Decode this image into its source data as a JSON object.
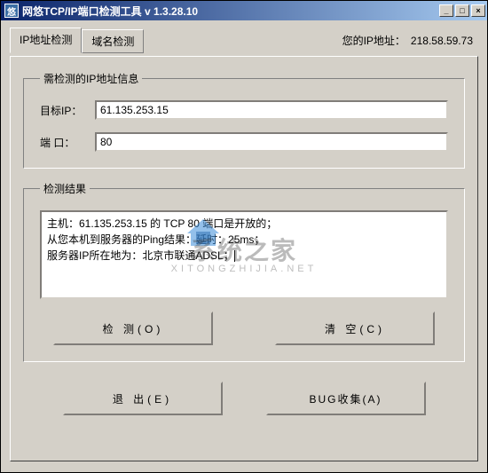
{
  "window": {
    "title": "网悠TCP/IP端口检测工具 v 1.3.28.10",
    "icon_text": "悠"
  },
  "header": {
    "ip_label": "您的IP地址：",
    "ip_value": "218.58.59.73"
  },
  "tabs": {
    "ip_check": "IP地址检测",
    "domain_check": "域名检测"
  },
  "input_group": {
    "legend": "需检测的IP地址信息",
    "target_ip_label": "目标IP：",
    "target_ip_value": "61.135.253.15",
    "port_label": "端 口：",
    "port_value": "80"
  },
  "result_group": {
    "legend": "检测结果",
    "lines": [
      "主机：61.135.253.15 的 TCP 80 端口是开放的；",
      "从您本机到服务器的Ping结果：延时：25ms；",
      "服务器IP所在地为：北京市联通ADSL；"
    ]
  },
  "buttons": {
    "check": "检 测(O)",
    "clear": "清 空(C)",
    "exit": "退 出(E)",
    "bug": "BUG收集(A)"
  },
  "watermark": {
    "main": "系统之家",
    "sub": "XITONGZHIJIA.NET"
  }
}
